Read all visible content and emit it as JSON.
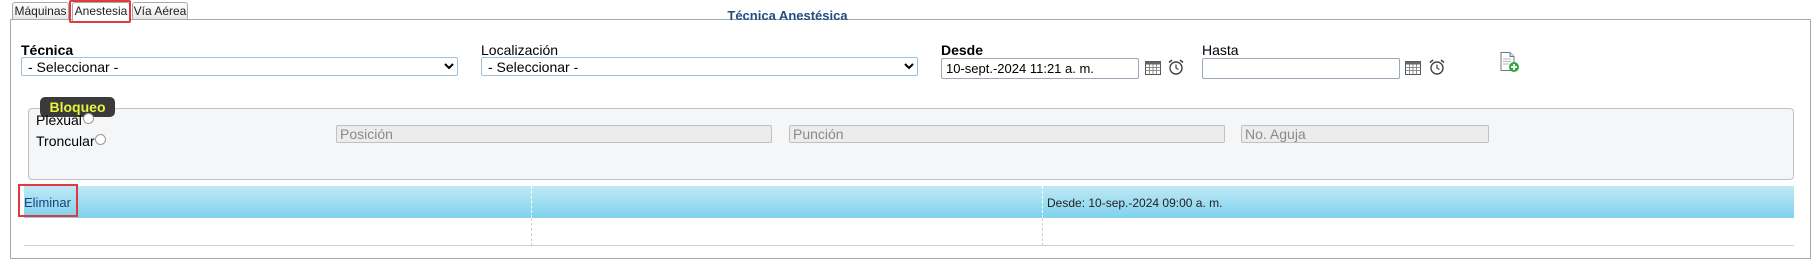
{
  "tabs": [
    {
      "label": "Máquinas"
    },
    {
      "label": "Anestesia",
      "active": true
    },
    {
      "label": "Vía Aérea"
    }
  ],
  "form": {
    "tecnica": {
      "label": "Técnica",
      "value": "- Seleccionar -"
    },
    "localizacion": {
      "label": "Localización",
      "value": "- Seleccionar -"
    },
    "desde": {
      "label": "Desde",
      "value": "10-sept.-2024 11:21 a. m."
    },
    "hasta": {
      "label": "Hasta",
      "value": ""
    }
  },
  "bloqueo": {
    "legend": "Bloqueo",
    "options": [
      "Plexual",
      "Troncular"
    ],
    "posicion_placeholder": "Posición",
    "puncion_placeholder": "Punción",
    "aguja_placeholder": "No. Aguja"
  },
  "table": {
    "header": "Técnica Anestésica",
    "rows": [
      {
        "action": "Eliminar",
        "col2": "",
        "col3": "Desde: 10-sep.-2024 09:00 a. m."
      }
    ]
  },
  "icons": [
    "calendar-icon",
    "alarm-clock-icon",
    "add-document-icon"
  ],
  "colors": {
    "accent": "#7fd2ec",
    "highlight": "#e0393e",
    "legend_bg": "#3a3a3a",
    "legend_text": "#e8f43a"
  }
}
